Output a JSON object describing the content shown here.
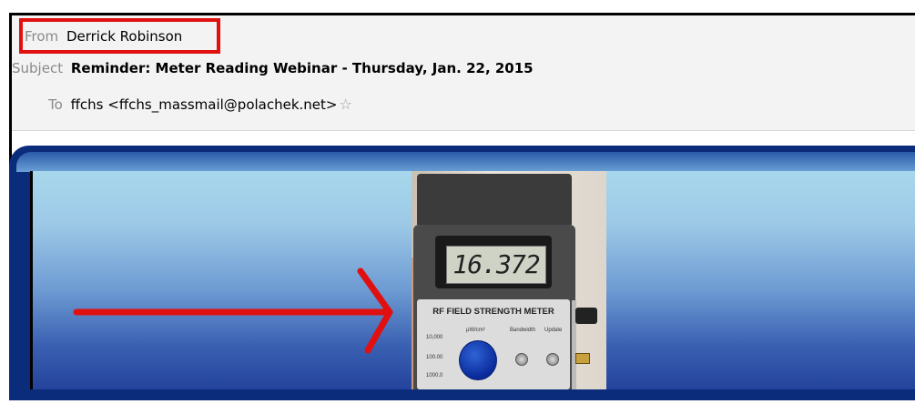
{
  "email_header": {
    "from_label": "From",
    "from_value": "Derrick Robinson",
    "subject_label": "Subject",
    "subject_value": "Reminder: Meter Reading Webinar - Thursday, Jan. 22, 2015",
    "to_label": "To",
    "to_value": "ffchs <ffchs_massmail@polachek.net>",
    "star_icon": "star-icon"
  },
  "highlight_color": "#e01010",
  "meter": {
    "display_reading": "16.372",
    "panel_title": "RF FIELD STRENGTH METER",
    "unit_label": "μW/cm²",
    "scale_labels": [
      "10,000",
      "100.00",
      "1000.0"
    ],
    "bandwidth_label": "Bandwidth",
    "update_label": "Update"
  },
  "annotation": {
    "arrow_icon": "red-arrow-icon",
    "color": "#e01010"
  }
}
